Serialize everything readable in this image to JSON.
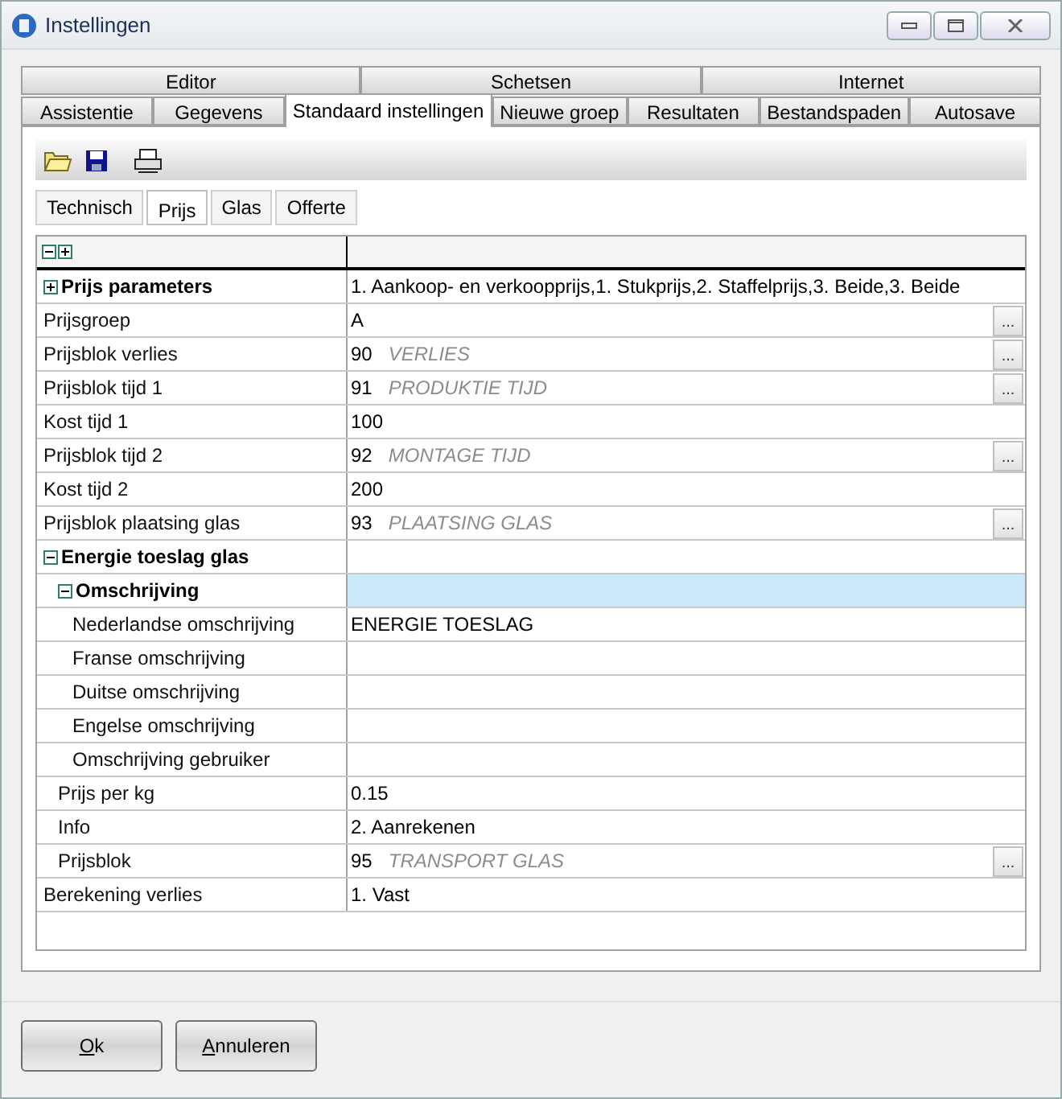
{
  "window": {
    "title": "Instellingen"
  },
  "tab_rows": [
    [
      {
        "label": "Editor",
        "selected": false
      },
      {
        "label": "Schetsen",
        "selected": false
      },
      {
        "label": "Internet",
        "selected": false
      }
    ],
    [
      {
        "label": "Assistentie",
        "selected": false
      },
      {
        "label": "Gegevens",
        "selected": false
      },
      {
        "label": "Standaard instellingen",
        "selected": true
      },
      {
        "label": "Nieuwe groep",
        "selected": false
      },
      {
        "label": "Resultaten",
        "selected": false
      },
      {
        "label": "Bestandspaden",
        "selected": false
      },
      {
        "label": "Autosave",
        "selected": false
      }
    ]
  ],
  "sub_tabs": [
    {
      "label": "Technisch",
      "selected": false
    },
    {
      "label": "Prijs",
      "selected": true
    },
    {
      "label": "Glas",
      "selected": false
    },
    {
      "label": "Offerte",
      "selected": false
    }
  ],
  "grid": {
    "rows": [
      {
        "kind": "group",
        "label": "Prijs parameters",
        "expanded": false,
        "selected": false,
        "value": "1. Aankoop- en verkoopprijs,1. Stukprijs,2. Staffelprijs,3. Beide,3. Beide"
      },
      {
        "kind": "property",
        "label": "Prijsgroep",
        "selected": false,
        "value": "A",
        "button": "..."
      },
      {
        "kind": "property",
        "label": "Prijsblok verlies",
        "selected": false,
        "value": "90",
        "hint": "VERLIES",
        "button": "..."
      },
      {
        "kind": "property",
        "label": "Prijsblok tijd 1",
        "selected": false,
        "value": "91",
        "hint": "PRODUKTIE TIJD",
        "button": "..."
      },
      {
        "kind": "property",
        "label": "Kost tijd 1",
        "selected": false,
        "value": "100"
      },
      {
        "kind": "property",
        "label": "Prijsblok tijd 2",
        "selected": false,
        "value": "92",
        "hint": "MONTAGE TIJD",
        "button": "..."
      },
      {
        "kind": "property",
        "label": "Kost tijd 2",
        "selected": false,
        "value": "200"
      },
      {
        "kind": "property",
        "label": "Prijsblok plaatsing glas",
        "selected": false,
        "value": "93",
        "hint": "PLAATSING GLAS",
        "button": "..."
      },
      {
        "kind": "group",
        "label": "Energie toeslag glas",
        "expanded": true,
        "selected": false,
        "children": [
          {
            "kind": "group",
            "label": "Omschrijving",
            "expanded": true,
            "selected": true,
            "children": [
              {
                "kind": "property",
                "label": "Nederlandse omschrijving",
                "selected": false,
                "value": "ENERGIE TOESLAG"
              },
              {
                "kind": "property",
                "label": "Franse omschrijving",
                "selected": false
              },
              {
                "kind": "property",
                "label": "Duitse omschrijving",
                "selected": false
              },
              {
                "kind": "property",
                "label": "Engelse omschrijving",
                "selected": false
              },
              {
                "kind": "property",
                "label": "Omschrijving gebruiker",
                "selected": false
              }
            ]
          },
          {
            "kind": "property",
            "label": "Prijs per kg",
            "selected": false,
            "value": "0.15"
          },
          {
            "kind": "property",
            "label": "Info",
            "selected": false,
            "value": "2. Aanrekenen"
          },
          {
            "kind": "property",
            "label": "Prijsblok",
            "selected": false,
            "value": "95",
            "hint": "TRANSPORT GLAS",
            "button": "..."
          }
        ]
      },
      {
        "kind": "property",
        "label": "Berekening verlies",
        "selected": false,
        "value": "1. Vast"
      }
    ]
  },
  "buttons": [
    {
      "label": "Ok"
    },
    {
      "label": "Annuleren"
    }
  ]
}
